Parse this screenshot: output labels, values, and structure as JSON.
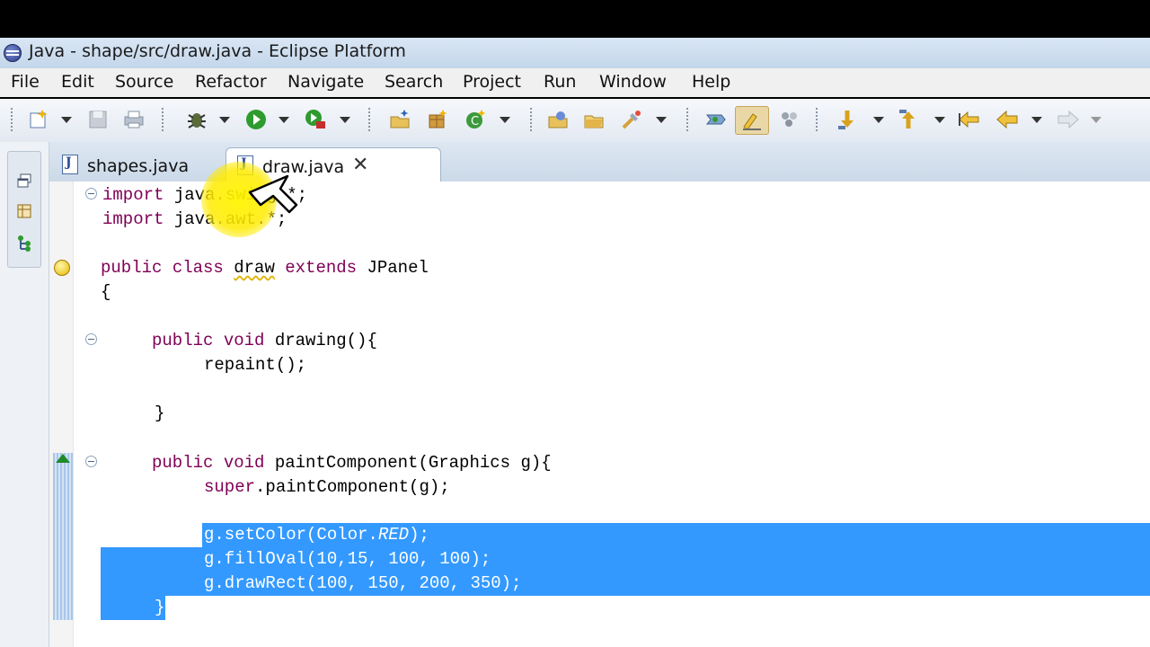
{
  "window": {
    "title": "Java - shape/src/draw.java - Eclipse Platform"
  },
  "menu": [
    "File",
    "Edit",
    "Source",
    "Refactor",
    "Navigate",
    "Search",
    "Project",
    "Run",
    "Window",
    "Help"
  ],
  "toolbar": {
    "icons": [
      "new-wizard-icon",
      "save-icon",
      "print-icon",
      "debug-icon",
      "run-icon",
      "run-external-tool-icon",
      "new-java-project-icon",
      "new-package-icon",
      "new-class-icon",
      "open-type-icon",
      "open-folder-icon",
      "search-icon",
      "toggle-breadcrumb-icon",
      "mark-occurrences-icon",
      "show-whitespace-icon",
      "next-annotation-icon",
      "previous-annotation-icon",
      "last-edit-location-icon",
      "back-icon",
      "forward-icon"
    ]
  },
  "tabs": [
    {
      "label": "shapes.java",
      "active": false
    },
    {
      "label": "draw.java",
      "active": true
    }
  ],
  "code": {
    "lines": [
      [
        "import java.swing.*;",
        "import",
        " java.swing.*;"
      ],
      [
        "import java.awt.*;",
        "import",
        " java.awt.*;"
      ]
    ],
    "l1_kw": "import",
    "l1_rest": " java.swing.*;",
    "l2_kw": "import",
    "l2_rest": " java.awt.*;",
    "l3_kw1": "public class",
    "l3_name": "draw",
    "l3_kw2": "extends",
    "l3_rest": " JPanel",
    "l4": "{",
    "l5_kw": "public void",
    "l5_rest": " drawing(){",
    "l6": "repaint();",
    "l7": "}",
    "l8_kw": "public void",
    "l8_rest": " paintComponent(Graphics g){",
    "l9_kw": "super",
    "l9_rest": ".paintComponent(g);",
    "l10_a": "g.setColor(Color.",
    "l10_b": "RED",
    "l10_c": ");",
    "l11": "g.fillOval(10,15, 100, 100);",
    "l12": "g.drawRect(100, 150, 200, 350);",
    "l13": "}"
  },
  "colors": {
    "keyword": "#7f0055",
    "selection": "#3399ff",
    "highlight": "#ffee00"
  }
}
